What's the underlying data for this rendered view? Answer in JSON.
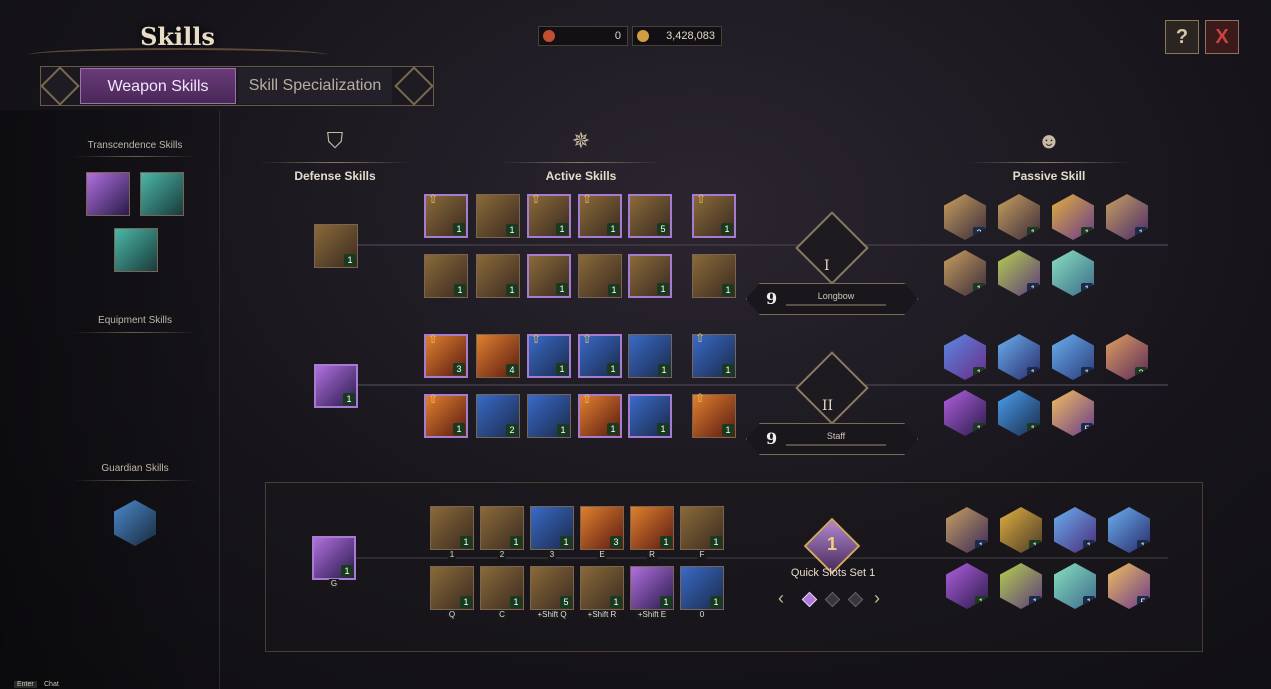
{
  "header": {
    "title": "Skills"
  },
  "tabs": [
    {
      "label": "Weapon Skills",
      "active": true
    },
    {
      "label": "Skill Specialization",
      "active": false
    }
  ],
  "currency": [
    {
      "icon": "skill-point-icon",
      "value": "0"
    },
    {
      "icon": "gold-coin-icon",
      "value": "3,428,083"
    }
  ],
  "top_buttons": [
    {
      "icon": "help-icon",
      "glyph": "?"
    },
    {
      "icon": "close-icon",
      "glyph": "X"
    }
  ],
  "sidebar": {
    "transcendence_label": "Transcendence Skills",
    "equipment_label": "Equipment Skills",
    "guardian_label": "Guardian Skills"
  },
  "columns": {
    "defense": "Defense Skills",
    "active": "Active Skills",
    "passive": "Passive Skill"
  },
  "weapons": [
    {
      "numeral": "I",
      "level": "9",
      "name": "Longbow"
    },
    {
      "numeral": "II",
      "level": "9",
      "name": "Staff"
    }
  ],
  "skill_levels": {
    "row1": [
      "1",
      "1",
      "1",
      "1",
      "5",
      "1"
    ],
    "row2": [
      "1",
      "1",
      "1",
      "1",
      "1",
      "1"
    ],
    "row3": [
      "3",
      "4",
      "1",
      "1",
      "1",
      "1"
    ],
    "row4": [
      "1",
      "2",
      "1",
      "1",
      "1",
      "1"
    ],
    "defense": [
      "1",
      "1"
    ],
    "passive1": [
      "2",
      "1",
      "1",
      "1",
      "1",
      "1",
      "1"
    ],
    "passive2": [
      "1",
      "1",
      "1",
      "3",
      "1",
      "1",
      "5"
    ]
  },
  "quick_slots": {
    "label": "Quick Slots Set 1",
    "badge": "1",
    "defense": {
      "level": "1",
      "key": "G"
    },
    "row1": [
      {
        "key": "1",
        "level": "1"
      },
      {
        "key": "2",
        "level": "1"
      },
      {
        "key": "3",
        "level": "1"
      },
      {
        "key": "E",
        "level": "3"
      },
      {
        "key": "R",
        "level": "1"
      },
      {
        "key": "F",
        "level": "1"
      }
    ],
    "row2": [
      {
        "key": "Q",
        "level": "1"
      },
      {
        "key": "C",
        "level": "1"
      },
      {
        "key": "+Shift Q",
        "level": "5"
      },
      {
        "key": "+Shift R",
        "level": "1"
      },
      {
        "key": "+Shift E",
        "level": "1"
      },
      {
        "key": "0",
        "level": "1"
      }
    ],
    "passive": [
      "1",
      "1",
      "1",
      "1",
      "1",
      "1",
      "1",
      "5"
    ]
  },
  "footer": {
    "key": "Enter",
    "label": "Chat"
  }
}
